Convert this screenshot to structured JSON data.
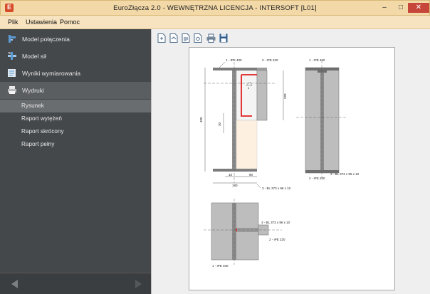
{
  "window": {
    "title": "EuroZłącza 2.0 - WEWNĘTRZNA LICENCJA - INTERSOFT [L01]"
  },
  "menu": [
    "Plik",
    "Ustawienia",
    "Pomoc"
  ],
  "sidebar": {
    "items": [
      {
        "label": "Model połączenia",
        "icon": "connection-model-icon"
      },
      {
        "label": "Model sił",
        "icon": "forces-model-icon"
      },
      {
        "label": "Wyniki wymiarowania",
        "icon": "results-icon"
      },
      {
        "label": "Wydruki",
        "icon": "printer-icon"
      }
    ],
    "subitems": [
      "Rysunek",
      "Raport wytężeń",
      "Raport skrócony",
      "Raport pełny"
    ],
    "selected_subitem": "Rysunek"
  },
  "toolbar": {
    "icons": [
      "new-document-icon",
      "open-document-icon",
      "document-text-icon",
      "print-preview-icon",
      "print-icon",
      "save-icon"
    ]
  },
  "drawing": {
    "labels": {
      "ipe400": "1 - IPE 400",
      "ipe220": "2 - IPE 220",
      "plate": "3 - BL 373 x 96 x 10",
      "dim_400": "400",
      "dim_220": "220",
      "dim_30": "30",
      "dim_10": "10",
      "dim_90": "90",
      "dim_180": "180",
      "weld": "4"
    }
  },
  "colors": {
    "sidebar": "#45484b",
    "titlebar": "#f3d9a8",
    "weld": "#e02020",
    "close": "#c7463a"
  }
}
